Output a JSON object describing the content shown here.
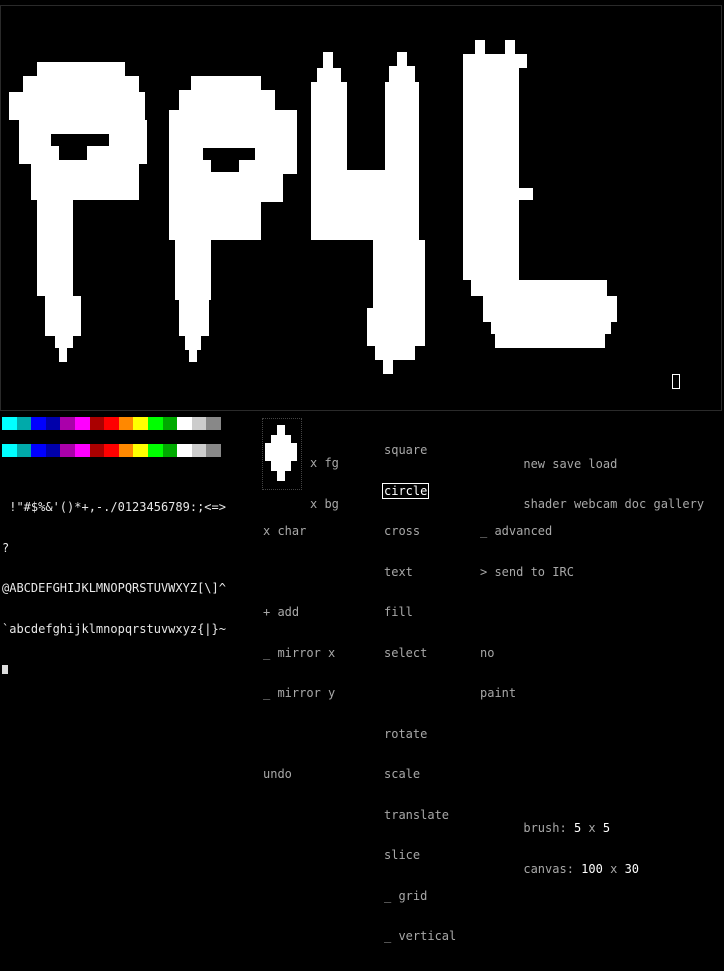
{
  "canvas": {
    "grid_width": 100,
    "grid_height": 30
  },
  "palette": {
    "fg_colors": [
      "#00ffff",
      "#00aaaa",
      "#0000ff",
      "#0000aa",
      "#aa00aa",
      "#ff00ff",
      "#aa0000",
      "#ff0000",
      "#ff8800",
      "#ffff00",
      "#00ff00",
      "#00aa00",
      "#ffffff",
      "#cccccc",
      "#888888"
    ],
    "bg_colors": [
      "#00ffff",
      "#00aaaa",
      "#0000ff",
      "#0000aa",
      "#aa00aa",
      "#ff00ff",
      "#aa0000",
      "#ff0000",
      "#ff8800",
      "#ffff00",
      "#00ff00",
      "#00aa00",
      "#ffffff",
      "#cccccc",
      "#888888"
    ]
  },
  "chars": {
    "line1": " !\"#$%&'()*+,-./0123456789:;<=>",
    "line2": "?",
    "line3": "@ABCDEFGHIJKLMNOPQRSTUVWXYZ[\\]^",
    "line4": "`abcdefghijklmnopqrstuvwxyz{|}~"
  },
  "labels": {
    "x_fg": "x fg",
    "x_bg": "x bg",
    "x_char": "x char",
    "add": "+ add",
    "mirror_x": "_ mirror x",
    "mirror_y": "_ mirror y",
    "undo": "undo"
  },
  "tools": {
    "square": "square",
    "circle": "circle",
    "cross": "cross",
    "text": "text",
    "fill": "fill",
    "select": "select",
    "rotate": "rotate",
    "scale": "scale",
    "translate": "translate",
    "slice": "slice",
    "grid": "_ grid",
    "vertical": "_ vertical"
  },
  "menu": {
    "new": "new",
    "save": "save",
    "load": "load",
    "shader": "shader",
    "webcam": "webcam",
    "doc": "doc",
    "gallery": "gallery",
    "advanced": "_ advanced",
    "send_irc": "> send to IRC",
    "no": "no",
    "paint": "paint"
  },
  "status": {
    "brush_label": "brush:",
    "brush_w": "5",
    "brush_x": "x",
    "brush_h": "5",
    "canvas_label": "canvas:",
    "canvas_w": "100",
    "canvas_x": "x",
    "canvas_h": "30"
  }
}
